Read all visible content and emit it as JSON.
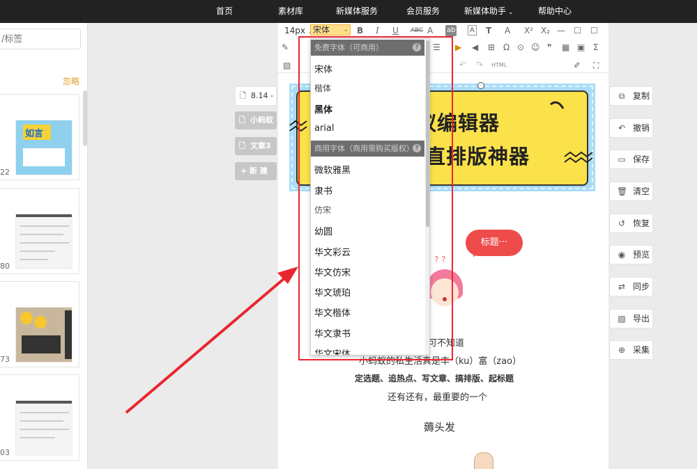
{
  "nav": [
    "首页",
    "素材库",
    "新媒体服务",
    "会员服务",
    "新媒体助手",
    "帮助中心"
  ],
  "nav_caret": "⌄",
  "sidebar": {
    "search_placeholder": "/标签",
    "ignore_label": "忽略",
    "counts": [
      "22",
      "80",
      "73",
      "03"
    ],
    "poster_text": "如言"
  },
  "docs": {
    "items": [
      "8.14 -",
      "小蚂蚁",
      "文章3"
    ],
    "new_label": "+ 新 建"
  },
  "toolbar": {
    "font_size": "14px",
    "font_name": "宋体",
    "html_label": "HTML",
    "row1": [
      "B",
      "I",
      "U",
      "ABC",
      "A",
      "ab",
      "A",
      "T",
      "A",
      "X²",
      "X₂",
      "☐",
      "☐"
    ],
    "row2_glyph_omega": "Ω",
    "row2_glyph_quote": "❞",
    "row2_glyph_sigma": "Σ"
  },
  "dropdown": {
    "free_header": "免费字体（可商用）",
    "free_fonts": [
      "宋体",
      "楷体",
      "黑体",
      "arial"
    ],
    "paid_header": "商用字体（商用需购买版权）",
    "paid_fonts": [
      "微软雅黑",
      "隶书",
      "仿宋",
      "幼圆",
      "华文彩云",
      "华文仿宋",
      "华文琥珀",
      "华文楷体",
      "华文隶书",
      "华文宋体"
    ],
    "help_mark": "?"
  },
  "banner": {
    "line1": "蚁编辑器",
    "line2": "直排版神器"
  },
  "content": {
    "bubble": "标题···",
    "qmarks": "? ?",
    "line1": "可不知道",
    "line2": "小蚂蚁的私生活真是丰（ku）富（zao）",
    "line3": "定选题、追热点、写文章、搞排版、起标题",
    "line4": "还有还有，最重要的一个",
    "line5": "薅头发"
  },
  "actions": [
    "复制",
    "撤销",
    "保存",
    "清空",
    "恢复",
    "预览",
    "同步",
    "导出",
    "采集"
  ],
  "colors": {
    "nav_bg": "#222222",
    "accent_yellow": "#fbe14a",
    "banner_blue": "#a9dcf7",
    "annotation_red": "#e8262f",
    "bubble_red": "#ee4b4b"
  }
}
